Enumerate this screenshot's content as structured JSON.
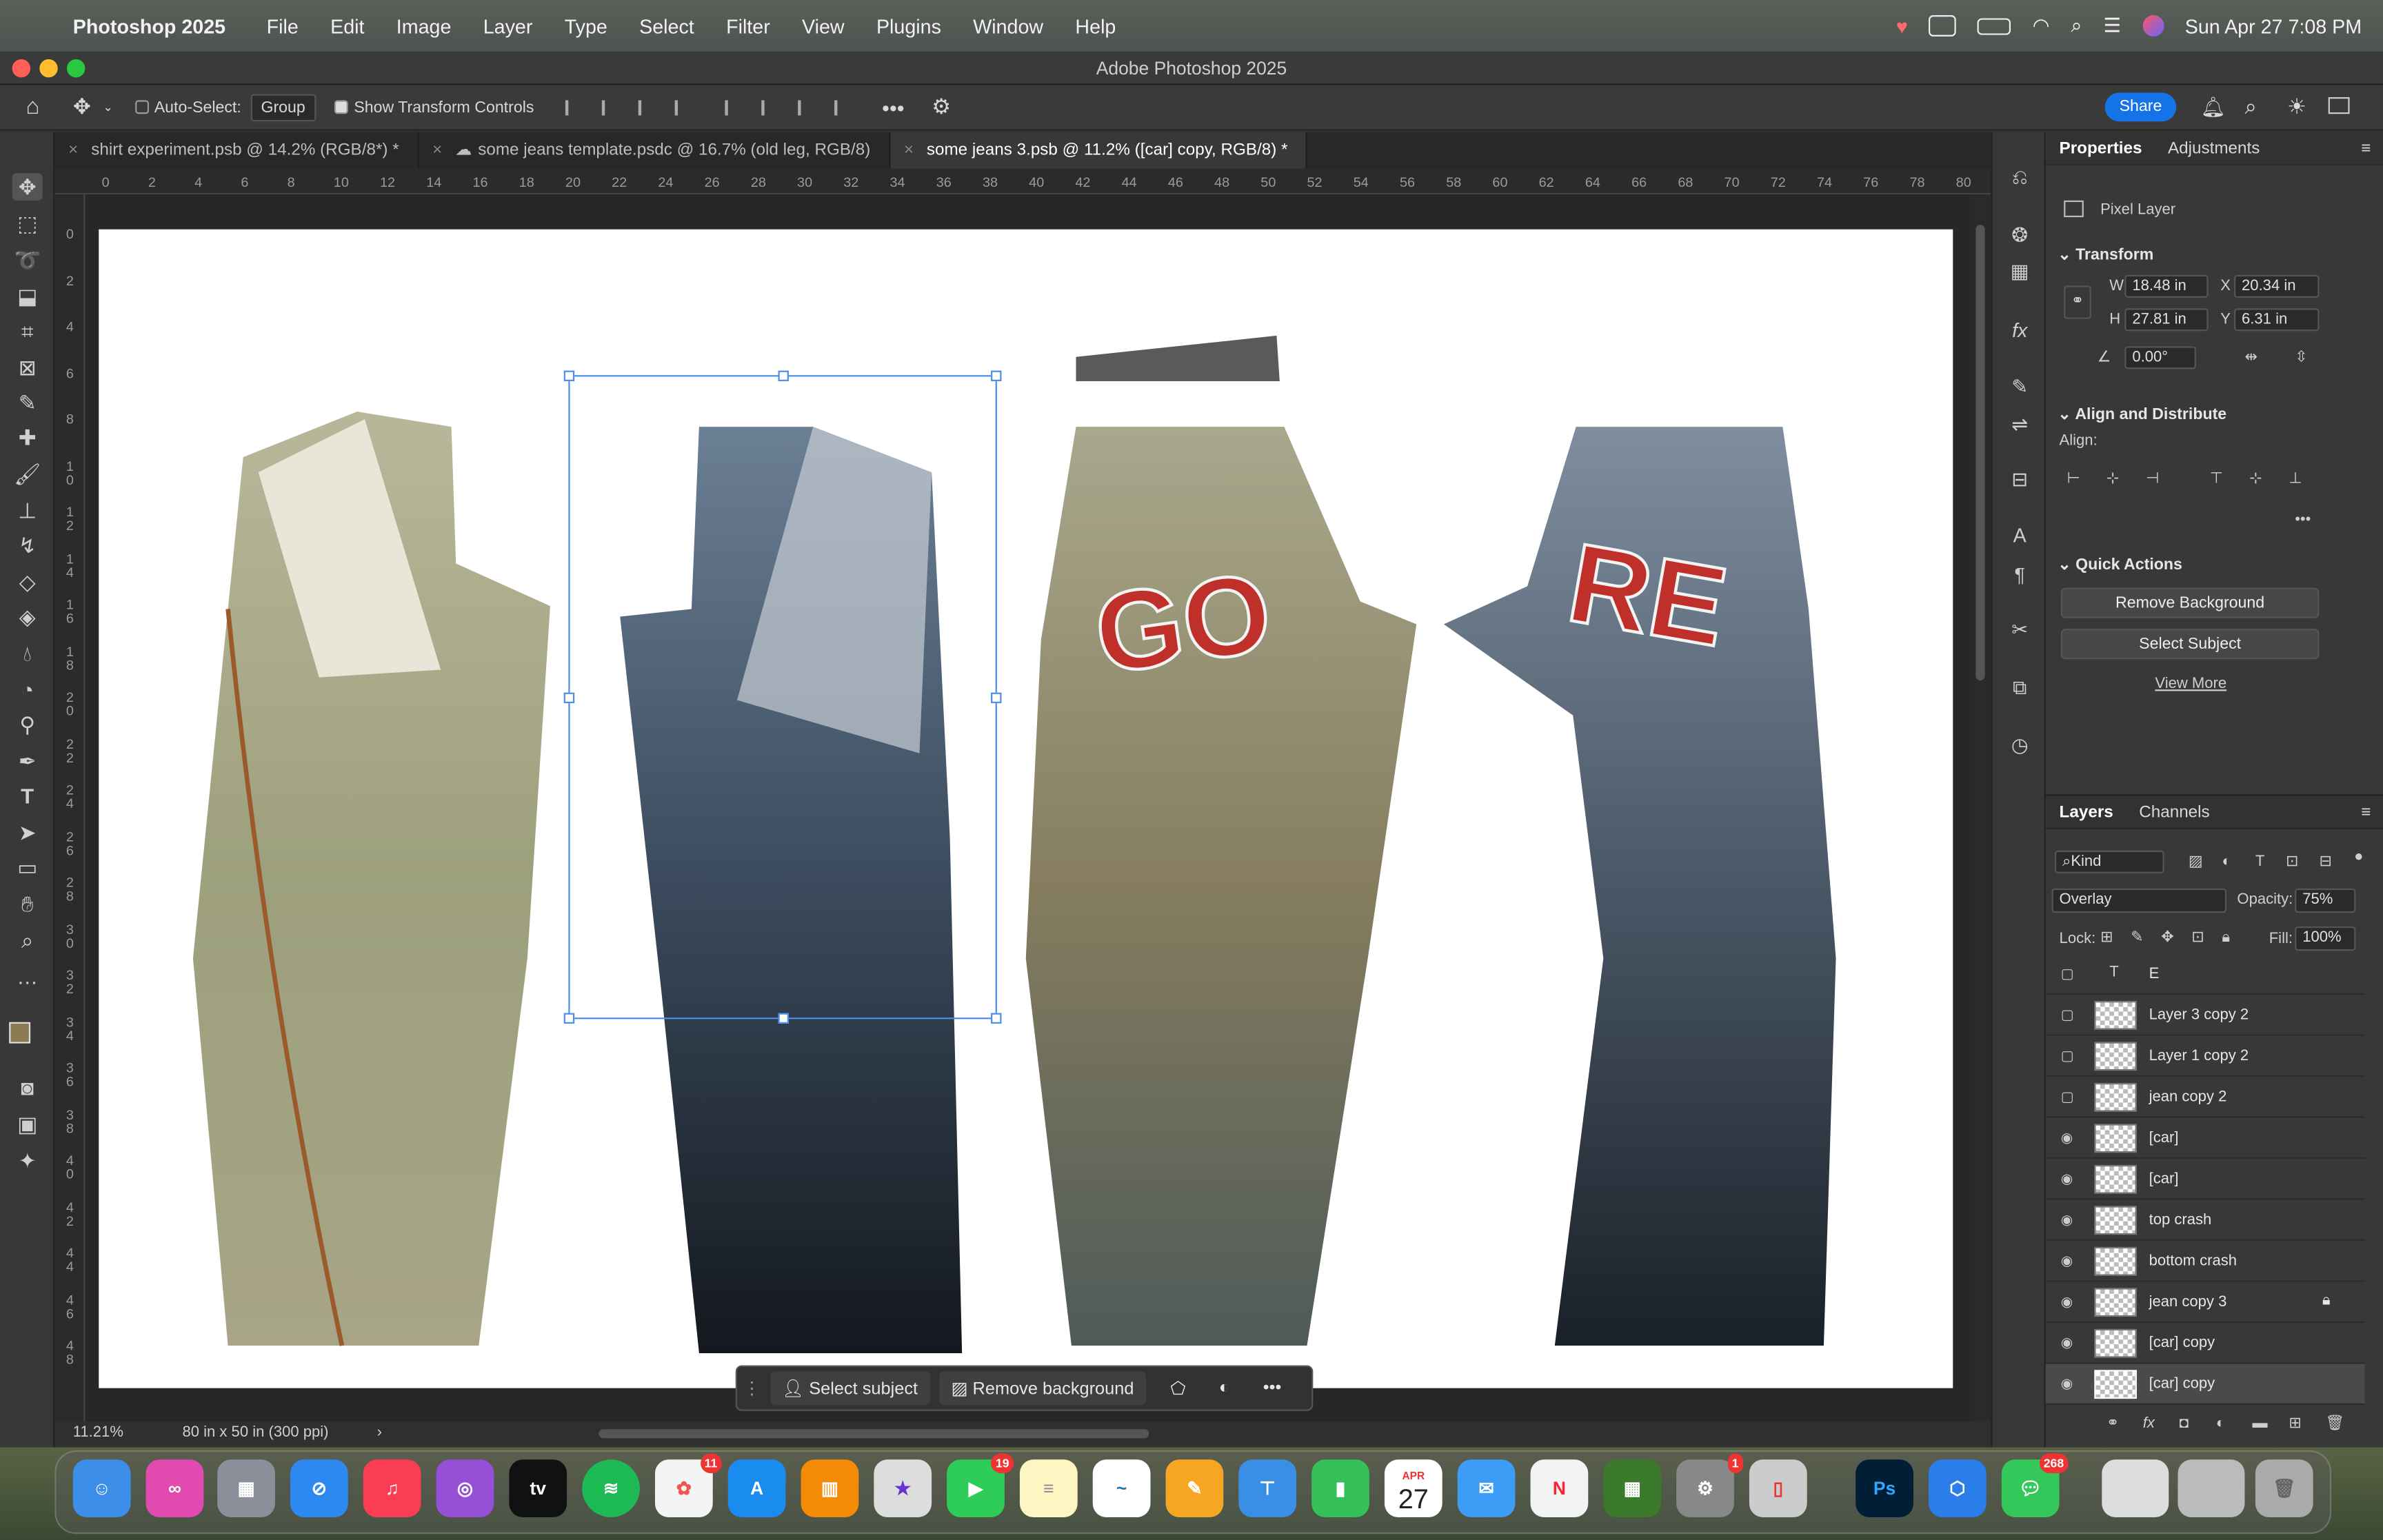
{
  "menubar": {
    "app": "Photoshop 2025",
    "items": [
      "File",
      "Edit",
      "Image",
      "Layer",
      "Type",
      "Select",
      "Filter",
      "View",
      "Plugins",
      "Window",
      "Help"
    ],
    "clock": "Sun Apr 27  7:08 PM"
  },
  "window": {
    "title": "Adobe Photoshop 2025"
  },
  "options": {
    "auto_select": "Auto-Select:",
    "group": "Group",
    "transform": "Show Transform Controls",
    "share": "Share"
  },
  "tabs": [
    {
      "label": "shirt experiment.psb @ 14.2% (RGB/8*) *"
    },
    {
      "label": "some jeans template.psdc @ 16.7% (old leg, RGB/8)"
    },
    {
      "label": "some jeans 3.psb @ 11.2% ([car] copy, RGB/8) *"
    }
  ],
  "ruler": {
    "h": [
      "0",
      "2",
      "4",
      "6",
      "8",
      "10",
      "12",
      "14",
      "16",
      "18",
      "20",
      "22",
      "24",
      "26",
      "28",
      "30",
      "32",
      "34",
      "36",
      "38",
      "40",
      "42",
      "44",
      "46",
      "48",
      "50",
      "52",
      "54",
      "56",
      "58",
      "60",
      "62",
      "64",
      "66",
      "68",
      "70",
      "72",
      "74",
      "76",
      "78",
      "80"
    ],
    "v": [
      "0",
      "2",
      "4",
      "6",
      "8",
      "1\n0",
      "1\n2",
      "1\n4",
      "1\n6",
      "1\n8",
      "2\n0",
      "2\n2",
      "2\n4",
      "2\n6",
      "2\n8",
      "3\n0",
      "3\n2",
      "3\n4",
      "3\n6",
      "3\n8",
      "4\n0",
      "4\n2",
      "4\n4",
      "4\n6",
      "4\n8"
    ]
  },
  "canvas_text": {
    "go": "GO",
    "re": "RE"
  },
  "contextbar": {
    "select_subject": "Select subject",
    "remove_background": "Remove background"
  },
  "status": {
    "zoom": "11.21%",
    "doc": "80 in x 50 in (300 ppi)"
  },
  "properties": {
    "tab1": "Properties",
    "tab2": "Adjustments",
    "layer_type": "Pixel Layer",
    "transform": "Transform",
    "w_label": "W",
    "w": "18.48 in",
    "x_label": "X",
    "x": "20.34 in",
    "h_label": "H",
    "h": "27.81 in",
    "y_label": "Y",
    "y": "6.31 in",
    "angle": "0.00°",
    "align": "Align and Distribute",
    "align_label": "Align:",
    "quick": "Quick Actions",
    "remove_bg": "Remove Background",
    "select_subject": "Select Subject",
    "view_more": "View More"
  },
  "layers": {
    "tab1": "Layers",
    "tab2": "Channels",
    "kind": "Kind",
    "blend": "Overlay",
    "opacity_label": "Opacity:",
    "opacity": "75%",
    "lock_label": "Lock:",
    "fill_label": "Fill:",
    "fill": "100%",
    "rows": [
      {
        "name": "E",
        "visible": false
      },
      {
        "name": "Layer 3 copy 2",
        "visible": false
      },
      {
        "name": "Layer 1 copy 2",
        "visible": false
      },
      {
        "name": "jean copy 2",
        "visible": false
      },
      {
        "name": "[car]",
        "visible": true
      },
      {
        "name": "[car]",
        "visible": true
      },
      {
        "name": "top crash",
        "visible": true
      },
      {
        "name": "bottom crash",
        "visible": true
      },
      {
        "name": "jean copy 3",
        "visible": true
      },
      {
        "name": "[car] copy",
        "visible": true
      },
      {
        "name": "[car] copy",
        "visible": true
      }
    ]
  },
  "dock": {
    "badges": {
      "photos": "11",
      "facetime": "19",
      "messages": "268",
      "settings": "1"
    },
    "calendar_month": "APR",
    "calendar_day": "27",
    "ps": "Ps"
  },
  "colors": {
    "accent": "#1473e6",
    "selection": "#4d8ee8",
    "go_red": "#c0302a"
  }
}
